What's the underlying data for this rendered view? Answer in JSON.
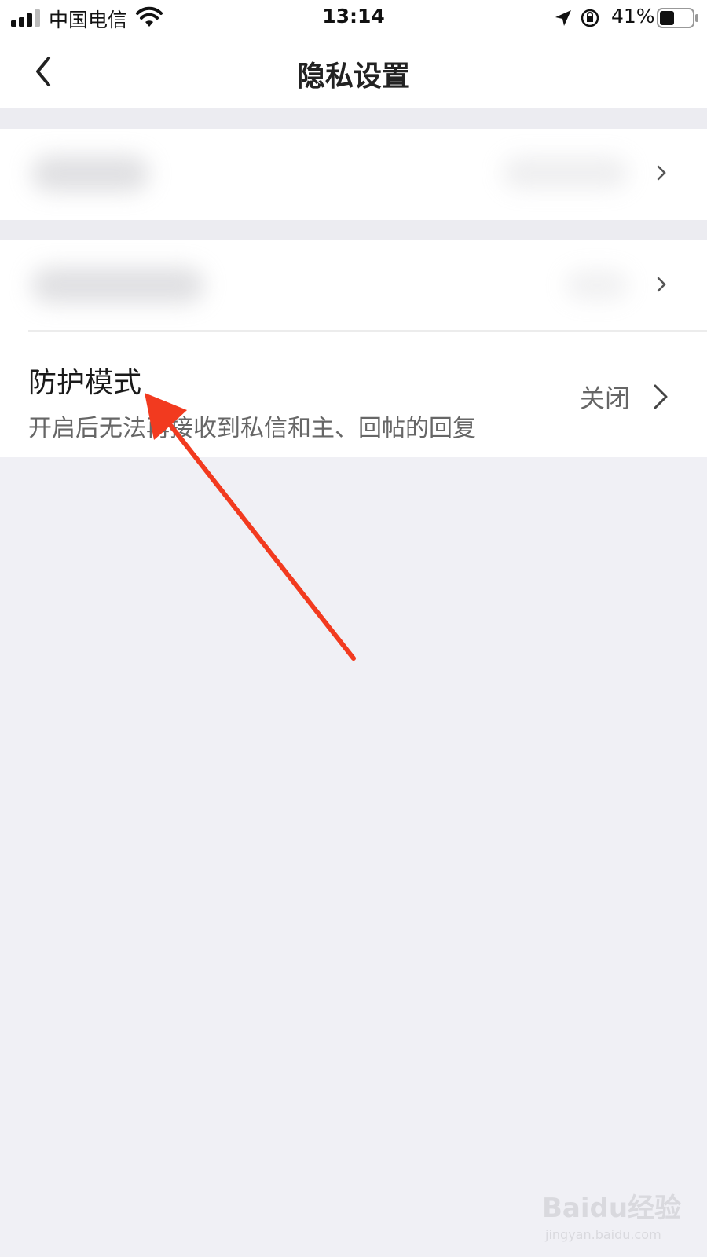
{
  "status_bar": {
    "carrier": "中国电信",
    "time": "13:14",
    "battery": "41%"
  },
  "nav": {
    "title": "隐私设置"
  },
  "protection_mode": {
    "title": "防护模式",
    "description": "开启后无法再接收到私信和主、回帖的回复",
    "value": "关闭"
  },
  "watermark": {
    "text": "Baidu经验",
    "subtext": "jingyan.baidu.com"
  },
  "colors": {
    "annotation_arrow": "#f23a1f",
    "background": "#f0f0f5"
  }
}
